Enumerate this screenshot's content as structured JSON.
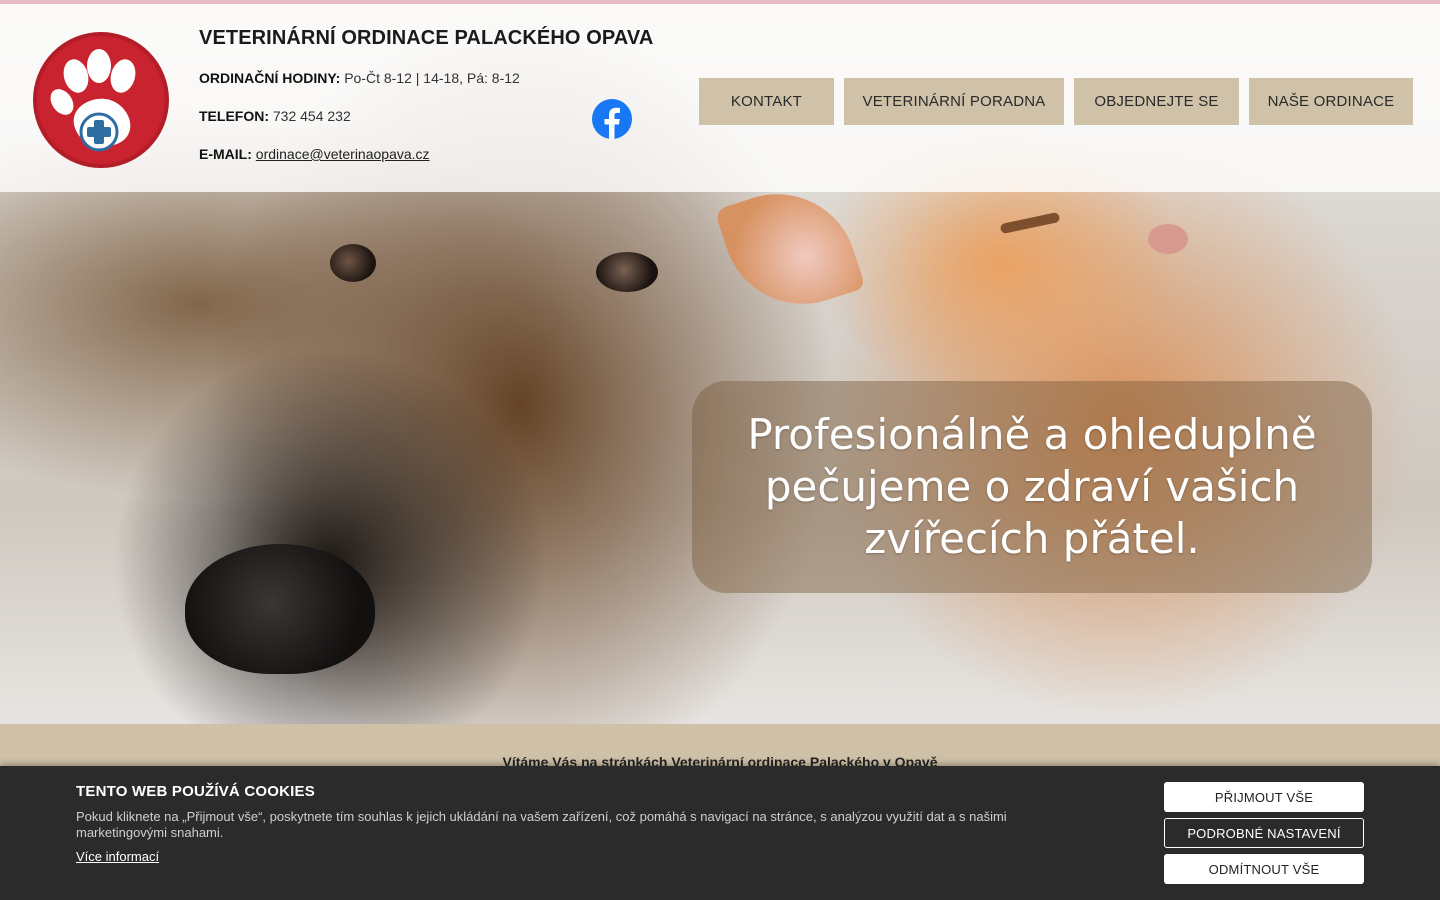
{
  "colors": {
    "top_strip": "#e8b9c6",
    "logo_red": "#c8232e",
    "nav_bg": "#cfc2a8",
    "welcome_band": "#cfc1a7",
    "cookie_bg": "#2b2b2b",
    "facebook_blue": "#1877f2"
  },
  "header": {
    "site_title": "VETERINÁRNÍ ORDINACE PALACKÉHO OPAVA",
    "hours_label": "ORDINAČNÍ HODINY:",
    "hours_value": "Po-Čt 8-12 | 14-18, Pá: 8-12",
    "phone_label": "TELEFON:",
    "phone_value": "732 454 232",
    "email_label": "E-MAIL:",
    "email_value": "ordinace@veterinaopava.cz",
    "social_icon": "facebook-icon",
    "logo_icon": "paw-with-cross-icon"
  },
  "nav": {
    "items": [
      {
        "label": "KONTAKT"
      },
      {
        "label": "VETERINÁRNÍ PORADNA"
      },
      {
        "label": "OBJEDNEJTE SE"
      },
      {
        "label": "NAŠE ORDINACE"
      }
    ]
  },
  "hero": {
    "slogan": "Profesionálně a ohleduplně pečujeme o zdraví vašich zvířecích přátel."
  },
  "main": {
    "welcome": "Vítáme Vás na stránkách Veterinární ordinace Palackého v Opavě"
  },
  "cookies": {
    "title": "TENTO WEB POUŽÍVÁ COOKIES",
    "text": "Pokud kliknete na „Přijmout vše“, poskytnete tím souhlas k jejich ukládání na vašem zařízení, což pomáhá s navigací na stránce, s analýzou využití dat a s našimi marketingovými snahami.",
    "more_link": "Více informací",
    "accept_all": "PŘIJMOUT VŠE",
    "settings": "PODROBNÉ NASTAVENÍ",
    "reject_all": "ODMÍTNOUT VŠE"
  }
}
